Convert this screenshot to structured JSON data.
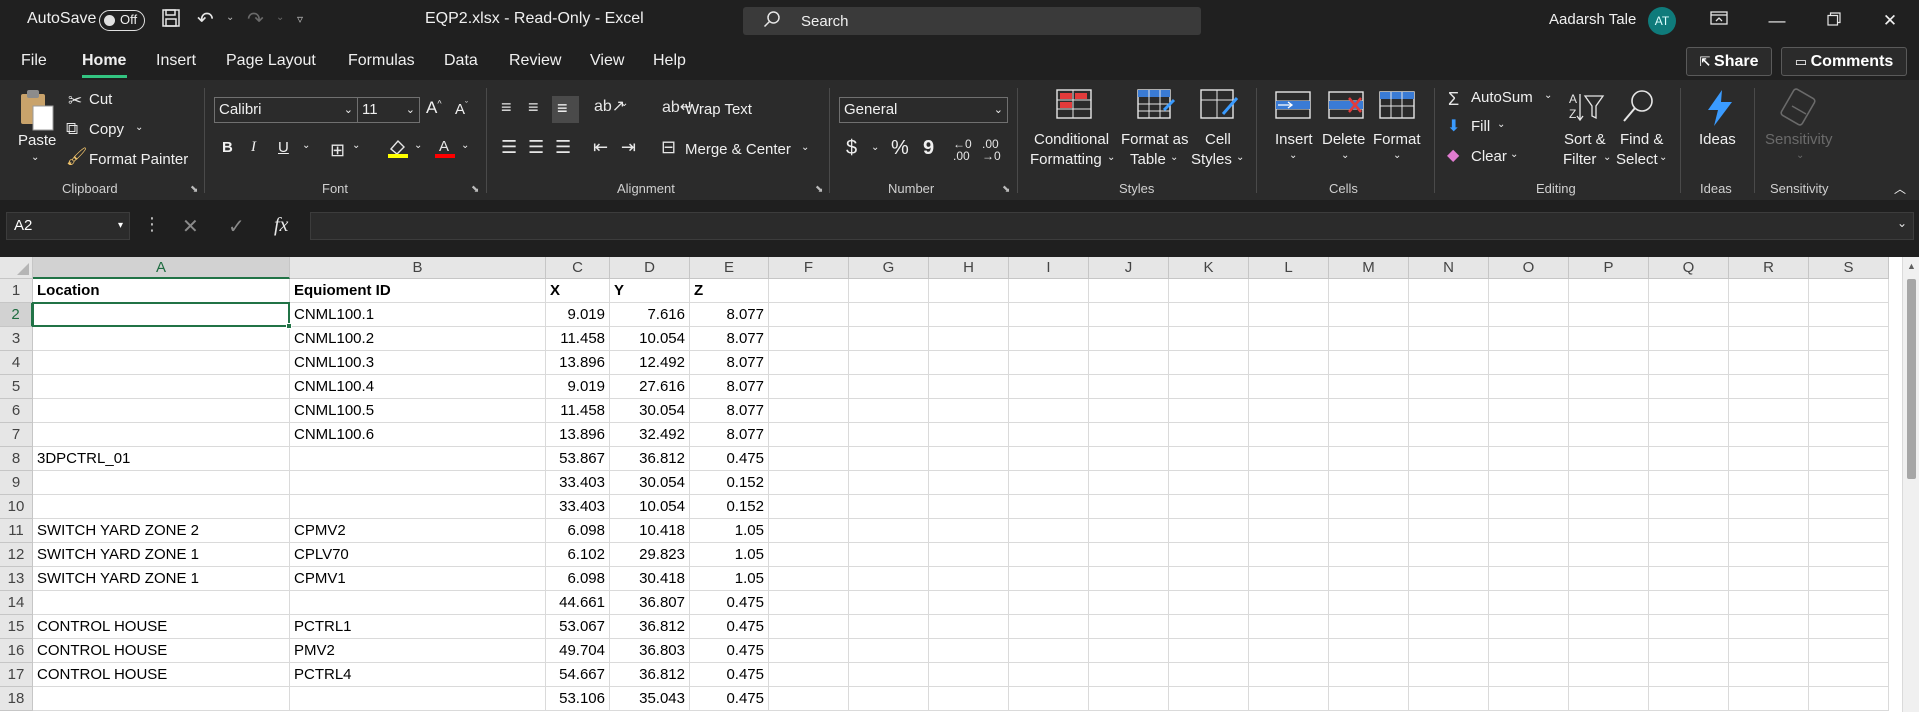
{
  "titlebar": {
    "autosave_label": "AutoSave",
    "autosave_state": "Off",
    "document_title": "EQP2.xlsx  -  Read-Only  -  Excel",
    "search_placeholder": "Search",
    "user_name": "Aadarsh Tale",
    "user_initials": "AT"
  },
  "tabs": [
    "File",
    "Home",
    "Insert",
    "Page Layout",
    "Formulas",
    "Data",
    "Review",
    "View",
    "Help"
  ],
  "active_tab": "Home",
  "share_label": "Share",
  "comments_label": "Comments",
  "ribbon": {
    "clipboard": {
      "paste": "Paste",
      "cut": "Cut",
      "copy": "Copy",
      "format_painter": "Format Painter",
      "label": "Clipboard"
    },
    "font": {
      "name": "Calibri",
      "size": "11",
      "bold": "B",
      "italic": "I",
      "underline": "U",
      "label": "Font"
    },
    "alignment": {
      "wrap_text": "Wrap Text",
      "merge_center": "Merge & Center",
      "label": "Alignment"
    },
    "number": {
      "format": "General",
      "currency": "$",
      "percent": "%",
      "comma": "9",
      "label": "Number"
    },
    "styles": {
      "conditional_formatting_1": "Conditional",
      "conditional_formatting_2": "Formatting",
      "format_as_table_1": "Format as",
      "format_as_table_2": "Table",
      "cell_styles_1": "Cell",
      "cell_styles_2": "Styles",
      "label": "Styles"
    },
    "cells": {
      "insert": "Insert",
      "delete": "Delete",
      "format": "Format",
      "label": "Cells"
    },
    "editing": {
      "autosum": "AutoSum",
      "fill": "Fill",
      "clear": "Clear",
      "sort_filter_1": "Sort &",
      "sort_filter_2": "Filter",
      "find_select_1": "Find &",
      "find_select_2": "Select",
      "label": "Editing"
    },
    "ideas": {
      "ideas": "Ideas",
      "label": "Ideas"
    },
    "sensitivity": {
      "sensitivity": "Sensitivity",
      "label": "Sensitivity"
    }
  },
  "formula_bar": {
    "name_box": "A2",
    "fx": "fx",
    "content": ""
  },
  "columns": [
    "A",
    "B",
    "C",
    "D",
    "E",
    "F",
    "G",
    "H",
    "I",
    "J",
    "K",
    "L",
    "M",
    "N",
    "O",
    "P",
    "Q",
    "R",
    "S"
  ],
  "rows": [
    {
      "n": "1",
      "A": "Location",
      "B": "Equioment ID",
      "C": "X",
      "D": "Y",
      "E": "Z"
    },
    {
      "n": "2",
      "A": "",
      "B": "CNML100.1",
      "C": "9.019",
      "D": "7.616",
      "E": "8.077"
    },
    {
      "n": "3",
      "A": "",
      "B": "CNML100.2",
      "C": "11.458",
      "D": "10.054",
      "E": "8.077"
    },
    {
      "n": "4",
      "A": "",
      "B": "CNML100.3",
      "C": "13.896",
      "D": "12.492",
      "E": "8.077"
    },
    {
      "n": "5",
      "A": "",
      "B": "CNML100.4",
      "C": "9.019",
      "D": "27.616",
      "E": "8.077"
    },
    {
      "n": "6",
      "A": "",
      "B": "CNML100.5",
      "C": "11.458",
      "D": "30.054",
      "E": "8.077"
    },
    {
      "n": "7",
      "A": "",
      "B": "CNML100.6",
      "C": "13.896",
      "D": "32.492",
      "E": "8.077"
    },
    {
      "n": "8",
      "A": "3DPCTRL_01",
      "B": "",
      "C": "53.867",
      "D": "36.812",
      "E": "0.475"
    },
    {
      "n": "9",
      "A": "",
      "B": "",
      "C": "33.403",
      "D": "30.054",
      "E": "0.152"
    },
    {
      "n": "10",
      "A": "",
      "B": "",
      "C": "33.403",
      "D": "10.054",
      "E": "0.152"
    },
    {
      "n": "11",
      "A": "SWITCH YARD ZONE 2",
      "B": "CPMV2",
      "C": "6.098",
      "D": "10.418",
      "E": "1.05"
    },
    {
      "n": "12",
      "A": "SWITCH YARD ZONE 1",
      "B": "CPLV70",
      "C": "6.102",
      "D": "29.823",
      "E": "1.05"
    },
    {
      "n": "13",
      "A": "SWITCH YARD ZONE 1",
      "B": "CPMV1",
      "C": "6.098",
      "D": "30.418",
      "E": "1.05"
    },
    {
      "n": "14",
      "A": "",
      "B": "",
      "C": "44.661",
      "D": "36.807",
      "E": "0.475"
    },
    {
      "n": "15",
      "A": "CONTROL HOUSE",
      "B": "PCTRL1",
      "C": "53.067",
      "D": "36.812",
      "E": "0.475"
    },
    {
      "n": "16",
      "A": "CONTROL HOUSE",
      "B": "PMV2",
      "C": "49.704",
      "D": "36.803",
      "E": "0.475"
    },
    {
      "n": "17",
      "A": "CONTROL HOUSE",
      "B": "PCTRL4",
      "C": "54.667",
      "D": "36.812",
      "E": "0.475"
    },
    {
      "n": "18",
      "A": "",
      "B": "",
      "C": "53.106",
      "D": "35.043",
      "E": "0.475"
    }
  ],
  "selected_cell": "A2"
}
